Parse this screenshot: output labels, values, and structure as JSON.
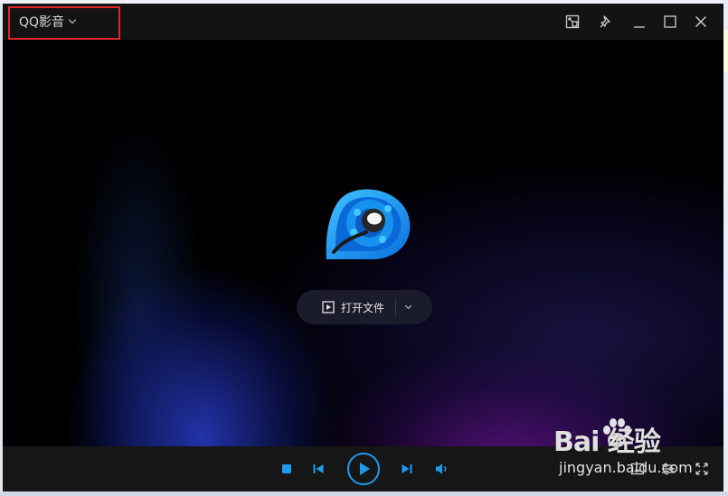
{
  "app": {
    "title": "QQ影音"
  },
  "titlebar": {
    "buttons": [
      "mini-mode-icon",
      "pin-icon",
      "minimize-icon",
      "maximize-icon",
      "close-icon"
    ]
  },
  "main": {
    "open_file_label": "打开文件"
  },
  "controls": {
    "icons": [
      "stop-icon",
      "previous-icon",
      "play-icon",
      "next-icon",
      "volume-icon",
      "screenshot-icon",
      "settings-icon",
      "fullscreen-icon"
    ]
  },
  "watermark": {
    "brand": "Bai 经验",
    "url": "jingyan.baidu.com"
  },
  "colors": {
    "accent": "#1e9bf0",
    "highlight_box": "#e3232c"
  }
}
